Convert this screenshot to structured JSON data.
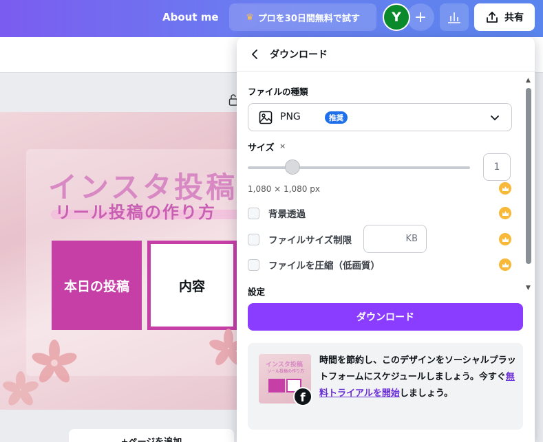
{
  "topbar": {
    "about_label": "About me",
    "pro_label": "プロを30日間無料で試す",
    "avatar_initial": "Y",
    "plus_symbol": "+",
    "share_label": "共有"
  },
  "design": {
    "title": "インスタ投稿",
    "subtitle": "リール投稿の作り方",
    "box_today": "本日の投稿",
    "box_content": "内容",
    "add_page_label": "+ページを追加"
  },
  "panel": {
    "title": "ダウンロード",
    "file_type_label": "ファイルの種類",
    "file_type_value": "PNG",
    "file_type_badge": "推奨",
    "size_label": "サイズ",
    "size_x": "×",
    "size_value": "1",
    "size_multiplier": 0.2,
    "dimensions": "1,080 × 1,080 px",
    "options": [
      {
        "label": "背景透過"
      },
      {
        "label": "ファイルサイズ制限"
      },
      {
        "label": "ファイルを圧縮（低画質）"
      }
    ],
    "kb_unit": "KB",
    "settings_label": "設定",
    "download_button": "ダウンロード",
    "promo": {
      "thumb_title": "インスタ投稿",
      "thumb_sub": "リール投稿の作り方",
      "text_before": "時間を節約し、このデザインをソーシャルプラットフォームにスケジュールしましょう。今すぐ",
      "link_text": "無料トライアルを開始",
      "text_after": "しましょう。"
    }
  },
  "colors": {
    "accent": "#8b3dff",
    "design_magenta": "#c63fa6",
    "badge_blue": "#1f6feb",
    "crown_gold": "#f8b93a"
  }
}
